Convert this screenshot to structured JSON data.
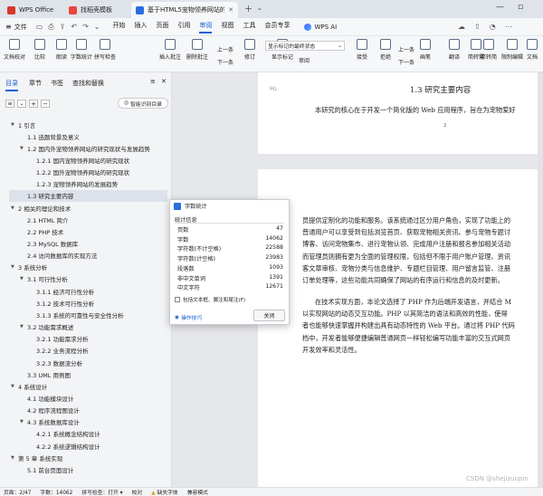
{
  "tabs": [
    {
      "label": "WPS Office",
      "color": "#d6362c"
    },
    {
      "label": "找稻壳模板",
      "color": "#e8453c"
    },
    {
      "label": "基于HTML5宠物领养网站的设",
      "color": "#2b6de0"
    }
  ],
  "menubar": {
    "file": "文件",
    "items": [
      "开始",
      "插入",
      "页面",
      "引用",
      "审阅",
      "视图",
      "工具",
      "会员专享"
    ],
    "active": "审阅",
    "ai": "WPS AI"
  },
  "toolbar": {
    "buttons": [
      "文档校对",
      "比较",
      "朗读",
      "字数统计",
      "拼写检查",
      "插入批注",
      "删除批注",
      "上一条",
      "下一条",
      "修订",
      "显示标记",
      "审阅",
      "接受",
      "拒绝",
      "上一条",
      "下一条",
      "画笔",
      "翻译",
      "简转繁",
      "繁转简",
      "限制编辑",
      "文档"
    ],
    "markup_select": "显示标记的最终状态"
  },
  "nav": {
    "tabs": [
      "目录",
      "章节",
      "书签",
      "查找和替换"
    ],
    "smart_toc": "智能识别目录",
    "items": [
      {
        "text": "1 引言",
        "level": 0,
        "arrow": true
      },
      {
        "text": "1.1 选题背景及意义",
        "level": 1
      },
      {
        "text": "1.2 国内外宠物领养网站的研究现状与发展趋势",
        "level": 1,
        "arrow": true
      },
      {
        "text": "1.2.1 国内宠物领养网站的研究现状",
        "level": 2
      },
      {
        "text": "1.2.2 国外宠物领养网站的研究现状",
        "level": 2
      },
      {
        "text": "1.2.3 宠物领养网站的发展趋势",
        "level": 2
      },
      {
        "text": "1.3 研究主要内容",
        "level": 1,
        "selected": true
      },
      {
        "text": "2 相关的理论和技术",
        "level": 0,
        "arrow": true
      },
      {
        "text": "2.1 HTML 简介",
        "level": 1
      },
      {
        "text": "2.2 PHP 技术",
        "level": 1
      },
      {
        "text": "2.3 MySQL 数据库",
        "level": 1
      },
      {
        "text": "2.4 访问数据库的实现方法",
        "level": 1
      },
      {
        "text": "3 系统分析",
        "level": 0,
        "arrow": true
      },
      {
        "text": "3.1 可行性分析",
        "level": 1,
        "arrow": true
      },
      {
        "text": "3.1.1 经济可行性分析",
        "level": 2
      },
      {
        "text": "3.1.2 技术可行性分析",
        "level": 2
      },
      {
        "text": "3.1.3 系统的可靠性与安全性分析",
        "level": 2
      },
      {
        "text": "3.2 功能需求概述",
        "level": 1,
        "arrow": true
      },
      {
        "text": "3.2.1 功能需求分析",
        "level": 2
      },
      {
        "text": "3.2.2 业务流程分析",
        "level": 2
      },
      {
        "text": "3.2.3 数据流分析",
        "level": 2
      },
      {
        "text": "3.3 UML 用例图",
        "level": 1
      },
      {
        "text": "4 系统设计",
        "level": 0,
        "arrow": true
      },
      {
        "text": "4.1 功能模块设计",
        "level": 1
      },
      {
        "text": "4.2 程序流程图设计",
        "level": 1
      },
      {
        "text": "4.3 系统数据库设计",
        "level": 1,
        "arrow": true
      },
      {
        "text": "4.2.1 系统概念结构设计",
        "level": 2
      },
      {
        "text": "4.2.2 系统逻辑结构设计",
        "level": 2
      },
      {
        "text": "第 5 章 系统实现",
        "level": 0,
        "arrow": true
      },
      {
        "text": "5.1 前台页面设计",
        "level": 1
      }
    ]
  },
  "document": {
    "header_mark": "H₂",
    "heading": "1.3 研究主要内容",
    "first_line": "本研究的核心在于开发一个简化版的 Web 应用程序，旨在为宠物爱好",
    "page_number": "2",
    "para1": [
      "员提供定制化的功能和服务。该系统通过区分用户角色，实现了功能上的",
      "普通用户可以享受到包括浏览首页、获取宠物相关资讯、参与宠物专题讨",
      "博客、访问宠物集市、进行宠物认领、完成用户注册和报名参加相关活动",
      "而管理员则拥有更为全面的管理权限，包括但不限于用户账户管理、资讯",
      "客文章审核、宠物分类与信息维护、专题栏目管理、用户留言监管、注册",
      "订单处理等，这些功能共同确保了网站的有序运行和信息的及时更新。"
    ],
    "para2": [
      "在技术实现方面，本论文选择了 PHP 作为后端开发语言，并结合 M",
      "以实现网站的动态交互功能。PHP 以其简洁的语法和高效的性能，使得",
      "者也能够快速掌握并构建出具有动态特性的 Web 平台。通过将 PHP 代码",
      "档中，开发者能够便捷编辑普通网页一样轻松编写功能丰富的交互式网页",
      "开发效率和灵活性。"
    ]
  },
  "dialog": {
    "title": "字数统计",
    "section": "统计信息",
    "rows": [
      {
        "label": "页数",
        "value": "47"
      },
      {
        "label": "字数",
        "value": "14062"
      },
      {
        "label": "字符数(不计空格)",
        "value": "22588"
      },
      {
        "label": "字符数(计空格)",
        "value": "23983"
      },
      {
        "label": "段落数",
        "value": "1093"
      },
      {
        "label": "非中文单词",
        "value": "1391"
      },
      {
        "label": "中文字符",
        "value": "12671"
      }
    ],
    "checkbox_label": "包括文本框、脚注和尾注(F)",
    "tips": "操作技巧",
    "close": "关闭"
  },
  "status": {
    "page": "页面：2/47",
    "words": "字数：14062",
    "spell": "拼写检查：打开 ▾",
    "proof": "校对",
    "font_missing": "缺失字体",
    "compat": "兼容模式"
  },
  "watermark": "CSDN @shejizuopin",
  "colors": {
    "accent": "#1a5fd6",
    "wps_red": "#d6362c"
  }
}
